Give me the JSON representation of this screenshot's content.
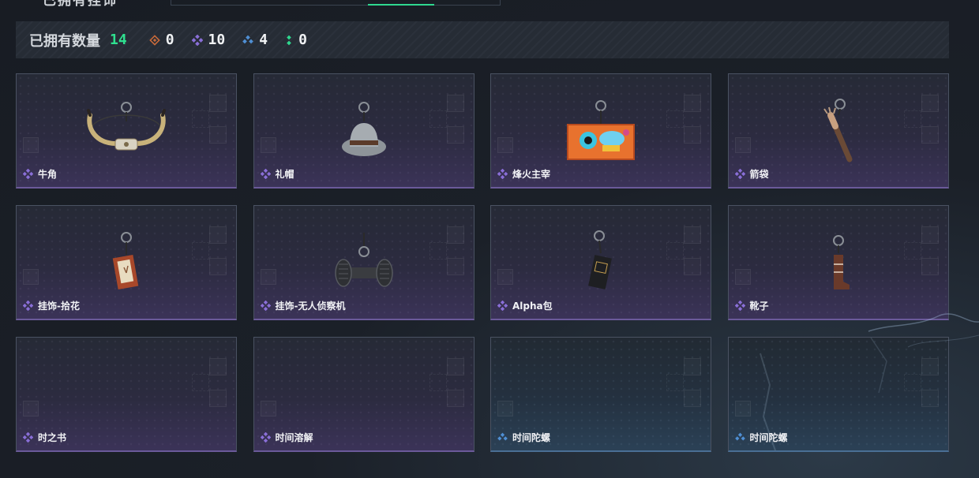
{
  "header": {
    "title": "已拥有挂饰"
  },
  "stats": {
    "label": "已拥有数量",
    "total": "14",
    "rarities": [
      {
        "icon": "orange-diamond-icon",
        "color": "#c86a3a",
        "count": "0"
      },
      {
        "icon": "purple-diamond-icon",
        "color": "#8a6fd8",
        "count": "10"
      },
      {
        "icon": "blue-diamond-icon",
        "color": "#4f8fd4",
        "count": "4"
      },
      {
        "icon": "green-dots-icon",
        "color": "#2fd88f",
        "count": "0"
      }
    ]
  },
  "items": [
    {
      "name": "牛角",
      "rarity": "purple"
    },
    {
      "name": "礼帽",
      "rarity": "purple"
    },
    {
      "name": "烽火主宰",
      "rarity": "purple"
    },
    {
      "name": "箭袋",
      "rarity": "purple"
    },
    {
      "name": "挂饰-拾花",
      "rarity": "purple"
    },
    {
      "name": "挂饰-无人侦察机",
      "rarity": "purple"
    },
    {
      "name": "Alpha包",
      "rarity": "purple"
    },
    {
      "name": "靴子",
      "rarity": "purple"
    },
    {
      "name": "时之书",
      "rarity": "purple"
    },
    {
      "name": "时间溶解",
      "rarity": "purple"
    },
    {
      "name": "时间陀螺",
      "rarity": "blue"
    },
    {
      "name": "时间陀螺",
      "rarity": "blue"
    }
  ],
  "colors": {
    "accent": "#2fd88f",
    "purple": "#8a6fd8",
    "blue": "#4f8fd4"
  }
}
